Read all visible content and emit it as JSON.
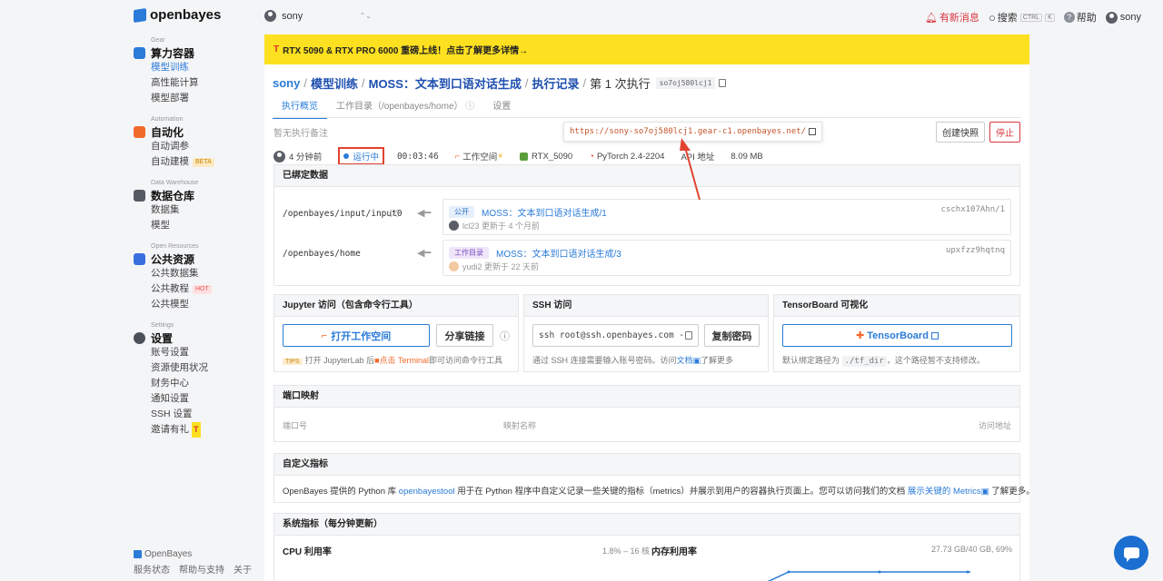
{
  "header": {
    "logo_text": "openbayes",
    "user_switch": "sony",
    "notice": "有新消息",
    "search": "搜索",
    "search_kbd1": "CTRL",
    "search_kbd2": "K",
    "help": "帮助",
    "user": "sony"
  },
  "sidebar": {
    "sections": [
      {
        "eng": "Gear",
        "title": "算力容器",
        "items": [
          "模型训练",
          "高性能计算",
          "模型部署"
        ]
      },
      {
        "eng": "Automation",
        "title": "自动化",
        "items": [
          "自动调参",
          "自动建模"
        ]
      },
      {
        "eng": "Data Warehouse",
        "title": "数据仓库",
        "items": [
          "数据集",
          "模型"
        ]
      },
      {
        "eng": "Open Resources",
        "title": "公共资源",
        "items": [
          "公共数据集",
          "公共教程",
          "公共模型"
        ]
      },
      {
        "eng": "Settings",
        "title": "设置",
        "items": [
          "账号设置",
          "资源使用状况",
          "财务中心",
          "通知设置",
          "SSH 设置",
          "邀请有礼"
        ]
      }
    ],
    "badge_beta": "BETA",
    "badge_hot": "HOT",
    "footer_brand": "OpenBayes",
    "footer_links": [
      "服务状态",
      "帮助与支持",
      "关于"
    ]
  },
  "banner": {
    "t": "T",
    "text": "RTX 5090 & RTX PRO 6000 重磅上线！点击了解更多详情→"
  },
  "breadcrumb": {
    "user": "sony",
    "training": "模型训练",
    "project": "MOSS：文本到口语对话生成",
    "records": "执行记录",
    "current": "第 1 次执行",
    "code": "so7oj580lcj1"
  },
  "tabs": [
    "执行概览",
    "工作目录（/openbayes/home）",
    "设置"
  ],
  "note": "暂无执行备注",
  "url_popup": "https://sony-so7oj580lcj1.gear-c1.openbayes.net/",
  "buttons": {
    "snapshot": "创建快照",
    "stop": "停止"
  },
  "meta": {
    "time_ago": "4 分钟前",
    "status": "运行中",
    "duration": "00:03:46",
    "workspace": "工作空间",
    "gpu": "RTX_5090",
    "framework": "PyTorch 2.4-2204",
    "api": "API 地址",
    "size": "8.09 MB"
  },
  "bound_data": {
    "title": "已绑定数据",
    "rows": [
      {
        "path": "/openbayes/input/input0",
        "tag": "公开",
        "name": "MOSS：文本到口语对话生成/1",
        "id": "cschx107Ahn/1",
        "user": "lcl23",
        "updated": "更新于 4 个月前"
      },
      {
        "path": "/openbayes/home",
        "tag": "工作目录",
        "name": "MOSS：文本到口语对话生成/3",
        "id": "upxfzz9hqtnq",
        "user": "yudi2",
        "updated": "更新于 22 天前"
      }
    ]
  },
  "jupyter": {
    "title": "Jupyter 访问（包含命令行工具）",
    "open": "打开工作空间",
    "share": "分享链接",
    "tips": "TIPS",
    "hint_pre": "打开 JupyterLab 后",
    "hint_click": "点击 Terminal",
    "hint_post": "即可访问命令行工具"
  },
  "ssh": {
    "title": "SSH 访问",
    "command": "ssh root@ssh.openbayes.com -",
    "copy_pwd": "复制密码",
    "hint_pre": "通过 SSH 连接需要输入账号密码。访问",
    "hint_link": "文档",
    "hint_post": "了解更多"
  },
  "tensorboard": {
    "title": "TensorBoard 可视化",
    "button": "TensorBoard",
    "hint_pre": "默认绑定路径为",
    "hint_code": "./tf_dir",
    "hint_post": "，这个路径暂不支持修改。"
  },
  "ports": {
    "title": "端口映射",
    "col1": "端口号",
    "col2": "映射名称",
    "col3": "访问地址"
  },
  "custom_metrics": {
    "title": "自定义指标",
    "pre": "OpenBayes 提供的 Python 库",
    "lib": "openbayestool",
    "mid": "用于在 Python 程序中自定义记录一些关键的指标（metrics）并展示到用户的容器执行页面上。您可以访问我们的文档",
    "link": "展示关键的 Metrics",
    "post": "了解更多。"
  },
  "system_metrics": {
    "title": "系统指标（每分钟更新）",
    "cpu_label": "CPU 利用率",
    "cpu_value": "1.8% – 16 核",
    "mem_label": "内存利用率",
    "mem_value": "27.73 GB/40 GB, 69%"
  },
  "colors": {
    "brand": "#2b7bd8",
    "banner": "#fde020",
    "alert": "#d9363e"
  }
}
